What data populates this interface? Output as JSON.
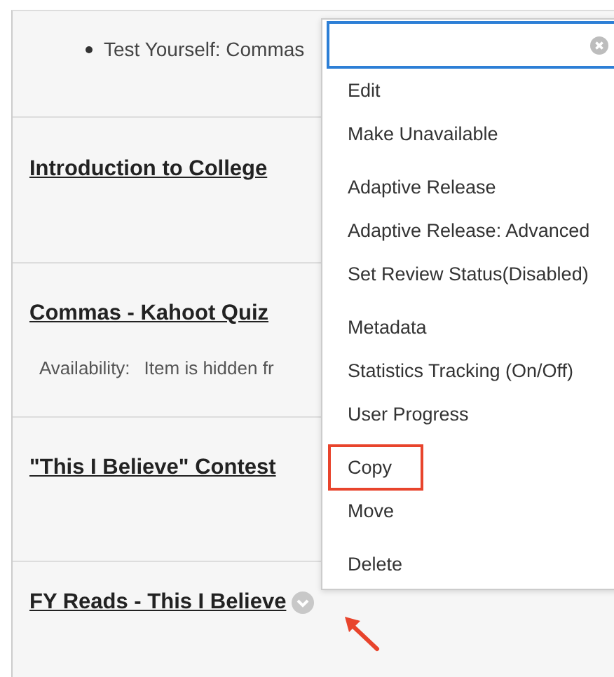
{
  "content": {
    "rows": [
      {
        "kind": "bullet",
        "text": "Test Yourself: Commas"
      },
      {
        "kind": "title",
        "title": "Introduction to College"
      },
      {
        "kind": "title",
        "title": "Commas - Kahoot Quiz",
        "details": [
          {
            "label": "Availability:",
            "value": "Item is hidden fr"
          }
        ]
      },
      {
        "kind": "title",
        "title": "\"This I Believe\" Contest"
      },
      {
        "kind": "title",
        "title": "FY Reads - This I Believe",
        "menu_button": true,
        "pointer_arrow": true
      }
    ]
  },
  "context_menu": {
    "groups": [
      {
        "items": [
          {
            "label": "Edit",
            "highlighted": false
          },
          {
            "label": "Make Unavailable",
            "highlighted": false
          }
        ]
      },
      {
        "items": [
          {
            "label": "Adaptive Release",
            "highlighted": false
          },
          {
            "label": "Adaptive Release: Advanced",
            "highlighted": false
          },
          {
            "label": "Set Review Status(Disabled)",
            "highlighted": false
          }
        ]
      },
      {
        "items": [
          {
            "label": "Metadata",
            "highlighted": false
          },
          {
            "label": "Statistics Tracking (On/Off)",
            "highlighted": false
          },
          {
            "label": "User Progress",
            "highlighted": false
          }
        ]
      },
      {
        "items": [
          {
            "label": "Copy",
            "highlighted": true
          },
          {
            "label": "Move",
            "highlighted": false
          }
        ]
      },
      {
        "items": [
          {
            "label": "Delete",
            "highlighted": false
          }
        ]
      }
    ]
  }
}
